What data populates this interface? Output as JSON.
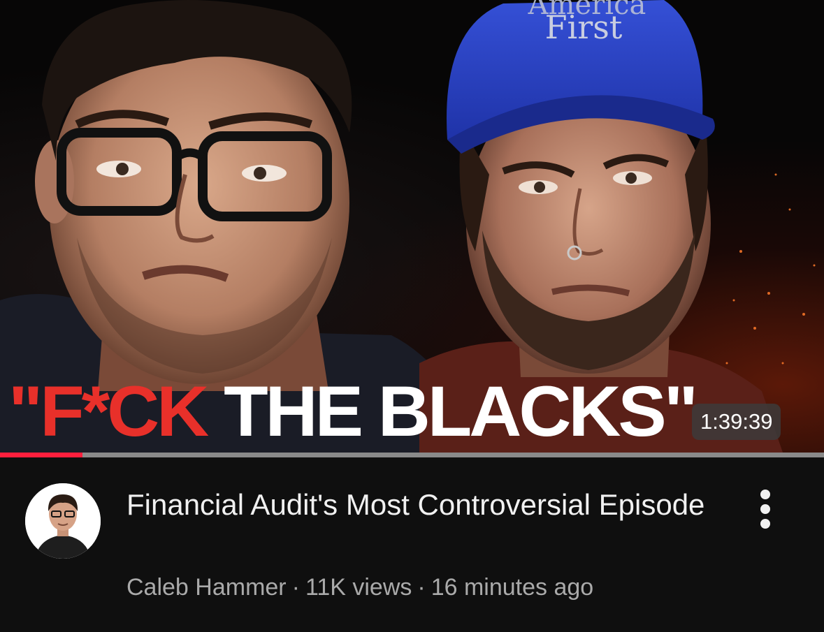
{
  "video": {
    "thumbnail": {
      "caption_red": "\"F*CK",
      "caption_white": " THE BLACKS\"",
      "hat_text_top": "America",
      "hat_text_bottom": "First",
      "duration": "1:39:39",
      "progress_fraction": 0.1
    },
    "title": "Financial Audit's Most Controversial Episode",
    "channel": "Caleb Hammer",
    "separator": "·",
    "views": "11K views",
    "uploaded": "16 minutes ago",
    "more_icon": "more-vertical-icon",
    "avatar_icon": "channel-avatar"
  },
  "colors": {
    "background": "#0f0f0f",
    "progress": "#ff1f3d",
    "caption_red": "#e8302a",
    "hat_blue": "#2b45c8"
  }
}
